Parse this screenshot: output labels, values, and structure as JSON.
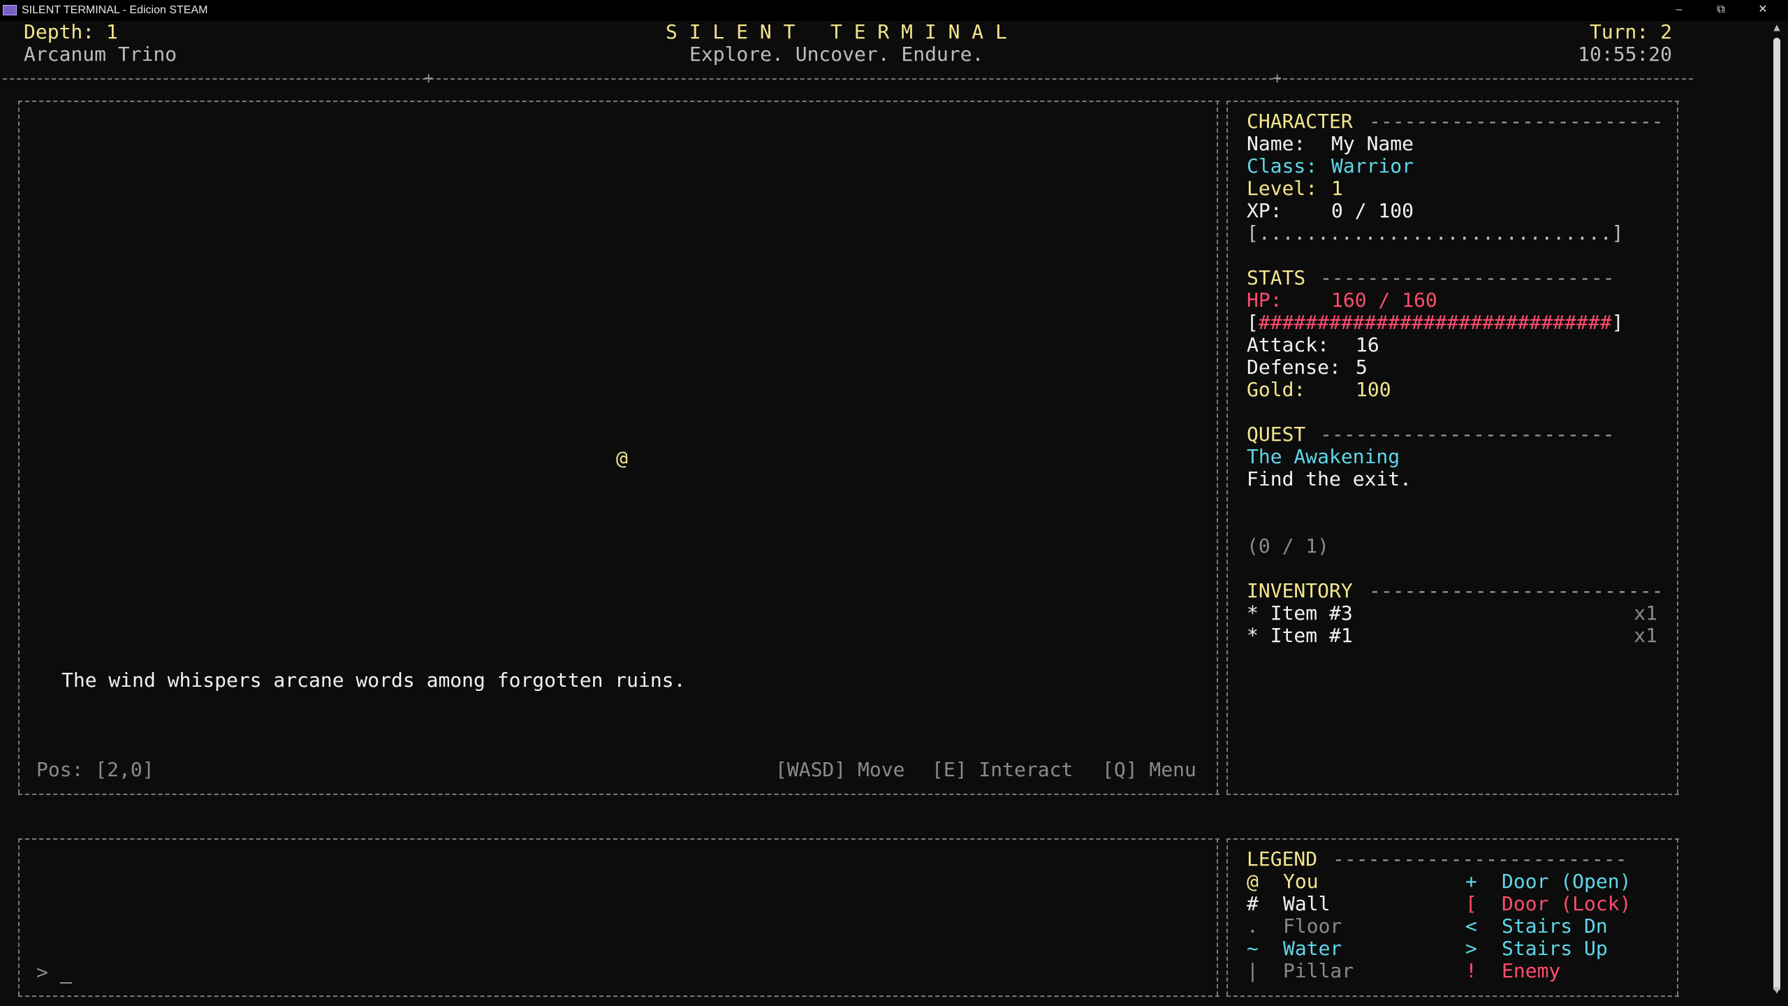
{
  "window": {
    "title": "SILENT TERMINAL - Edicion STEAM",
    "minimize": "–",
    "restore": "⧉",
    "close": "✕"
  },
  "header": {
    "depth": "Depth: 1",
    "location": "Arcanum Trino",
    "game_title": "S I L E N T   T E R M I N A L",
    "tagline": "Explore. Uncover. Endure.",
    "turn": "Turn: 2",
    "clock": "10:55:20"
  },
  "map": {
    "player_glyph": "@",
    "message": "The wind whispers arcane words among forgotten ruins.",
    "position": "Pos: [2,0]",
    "controls": [
      "[WASD] Move",
      "[E] Interact",
      "[Q] Menu"
    ]
  },
  "character": {
    "heading": "CHARACTER",
    "name_label": "Name:",
    "name": "My Name",
    "class_label": "Class:",
    "class": "Warrior",
    "level_label": "Level:",
    "level": "1",
    "xp_label": "XP:",
    "xp": "0 / 100",
    "xp_bar": "[..............................]"
  },
  "stats": {
    "heading": "STATS",
    "hp_label": "HP:",
    "hp": "160 / 160",
    "hp_bar_open": "[",
    "hp_bar_fill": "##############################",
    "hp_bar_close": "]",
    "attack_label": "Attack:",
    "attack": "16",
    "defense_label": "Defense:",
    "defense": "5",
    "gold_label": "Gold:",
    "gold": "100"
  },
  "quest": {
    "heading": "QUEST",
    "title": "The Awakening",
    "objective": "Find the exit.",
    "progress": "(0 / 1)"
  },
  "inventory": {
    "heading": "INVENTORY",
    "items": [
      {
        "name": "* Item #3",
        "qty": "x1"
      },
      {
        "name": "* Item #1",
        "qty": "x1"
      }
    ]
  },
  "legend": {
    "heading": "LEGEND",
    "left": [
      {
        "glyph": "@",
        "label": "You"
      },
      {
        "glyph": "#",
        "label": "Wall"
      },
      {
        "glyph": ".",
        "label": "Floor"
      },
      {
        "glyph": "~",
        "label": "Water"
      },
      {
        "glyph": "|",
        "label": "Pillar"
      }
    ],
    "right": [
      {
        "glyph": "+",
        "label": "Door (Open)"
      },
      {
        "glyph": "[",
        "label": "Door (Lock)"
      },
      {
        "glyph": "<",
        "label": "Stairs Dn"
      },
      {
        "glyph": ">",
        "label": "Stairs Up"
      },
      {
        "glyph": "!",
        "label": "Enemy"
      }
    ]
  },
  "console": {
    "prompt": ">",
    "cursor": "_"
  },
  "section_rule": "-------------------------",
  "colors": {
    "background": "#0c0c0c",
    "accent_yellow": "#f3e58d",
    "accent_cyan": "#5fd7e8",
    "accent_red": "#ff4d6d"
  }
}
